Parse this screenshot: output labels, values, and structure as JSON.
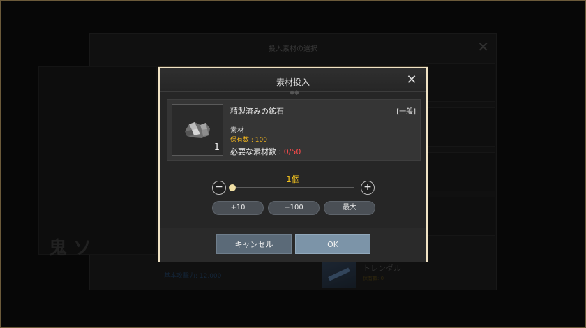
{
  "background": {
    "window_title": "投入素材の選択",
    "left_big_text": "鬼 ソ",
    "left_blue_text": "基本攻撃力: 12,000",
    "trend_name": "トレンダル",
    "trend_sub": "保有数: 0"
  },
  "dialog": {
    "title": "素材投入",
    "item": {
      "name": "精製済みの鉱石",
      "grade": "[一般]",
      "count": "1",
      "type": "素材",
      "owned": "保有数 : 100",
      "required_label": "必要な素材数 : ",
      "required_value": "0/50"
    },
    "quantity_label": "1個",
    "quantity_fraction": 0.0,
    "increment_buttons": [
      "+10",
      "+100",
      "最大"
    ],
    "cancel_label": "キャンセル",
    "ok_label": "OK"
  },
  "colors": {
    "accent_gold": "#f2c21e",
    "required_red": "#ff4b4b",
    "owned_yellow": "#f0b41e",
    "frame_border": "#f0e3c5"
  }
}
